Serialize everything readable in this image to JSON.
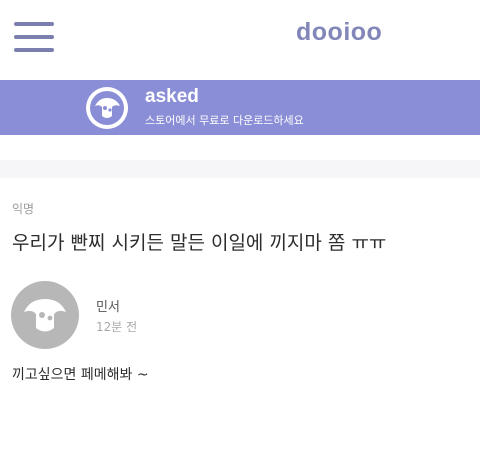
{
  "header": {
    "app_name": "dooioo",
    "menu_icon": "hamburger-menu-icon"
  },
  "banner": {
    "icon": "asked-logo-icon",
    "title": "asked",
    "subtitle": "스토어에서 무료로 다운로드하세요",
    "background_color": "#8a8ed6"
  },
  "post": {
    "author": "익명",
    "title": "우리가 빤찌 시키든 말든 이일에 끼지마 쫌 ㅠㅠ"
  },
  "comment": {
    "avatar_icon": "default-avatar-icon",
    "name": "민서",
    "time": "12분 전",
    "text": "끼고싶으면 페메해봐 ~"
  },
  "colors": {
    "accent": "#8286b8",
    "banner": "#8a8ed6",
    "avatar": "#b7b7b7"
  }
}
